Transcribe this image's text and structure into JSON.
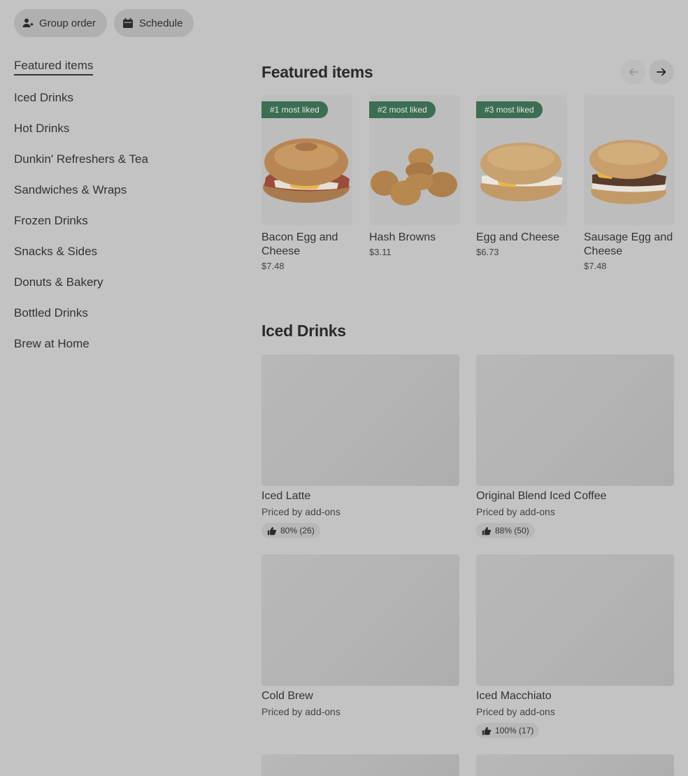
{
  "actions": {
    "group_order": "Group order",
    "schedule": "Schedule"
  },
  "sidebar": {
    "items": [
      {
        "label": "Featured items",
        "active": true
      },
      {
        "label": "Iced Drinks"
      },
      {
        "label": "Hot Drinks"
      },
      {
        "label": "Dunkin' Refreshers & Tea"
      },
      {
        "label": "Sandwiches & Wraps"
      },
      {
        "label": "Frozen Drinks"
      },
      {
        "label": "Snacks & Sides"
      },
      {
        "label": "Donuts & Bakery"
      },
      {
        "label": "Bottled Drinks"
      },
      {
        "label": "Brew at Home"
      }
    ]
  },
  "featured": {
    "title": "Featured items",
    "items": [
      {
        "badge": "#1 most liked",
        "name": "Bacon Egg and Cheese",
        "price": "$7.48"
      },
      {
        "badge": "#2 most liked",
        "name": "Hash Browns",
        "price": "$3.11"
      },
      {
        "badge": "#3 most liked",
        "name": "Egg and Cheese",
        "price": "$6.73"
      },
      {
        "badge": "",
        "name": "Sausage Egg and Cheese",
        "price": "$7.48"
      }
    ]
  },
  "iced": {
    "title": "Iced Drinks",
    "items": [
      {
        "name": "Iced Latte",
        "sub": "Priced by add-ons",
        "rating": "80% (26)"
      },
      {
        "name": "Original Blend Iced Coffee",
        "sub": "Priced by add-ons",
        "rating": "88% (50)"
      },
      {
        "name": "Cold Brew",
        "sub": "Priced by add-ons",
        "rating": ""
      },
      {
        "name": "Iced Macchiato",
        "sub": "Priced by add-ons",
        "rating": "100% (17)"
      }
    ]
  },
  "colors": {
    "overlay_bg": "#c3c3c3",
    "badge_bg": "#3b6e52"
  }
}
